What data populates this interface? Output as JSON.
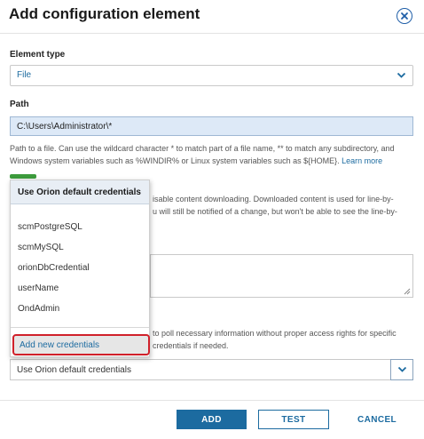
{
  "dialog": {
    "title": "Add configuration element"
  },
  "element_type": {
    "label": "Element type",
    "value": "File"
  },
  "path": {
    "label": "Path",
    "value": "C:\\Users\\Administrator\\*",
    "help_line1": "Path to a file. Can use the wildcard character * to match part of a file name, ** to match any subdirectory, and",
    "help_line2": "Windows system variables such as %WINDIR% or Linux system variables such as ${HOME}.",
    "learn_more": "Learn more"
  },
  "content_download": {
    "line1": "isable content downloading. Downloaded content is used for line-by-",
    "line2": "u will still be notified of a change, but won't be able to see the line-by-"
  },
  "credentials": {
    "help_line1": "to poll necessary information without proper access rights for specific",
    "help_line2": "credentials if needed.",
    "selected": "Use Orion default credentials"
  },
  "dropdown": {
    "header": "Use Orion default credentials",
    "items": [
      "scmPostgreSQL",
      "scmMySQL",
      "orionDbCredential",
      "userName",
      "OndAdmin"
    ],
    "add_new": "Add new credentials"
  },
  "footer": {
    "add": "ADD",
    "test": "TEST",
    "cancel": "CANCEL"
  },
  "colors": {
    "accent": "#1c6ba0",
    "highlight_border": "#d0202a",
    "toggle_on": "#3c9b3c"
  }
}
